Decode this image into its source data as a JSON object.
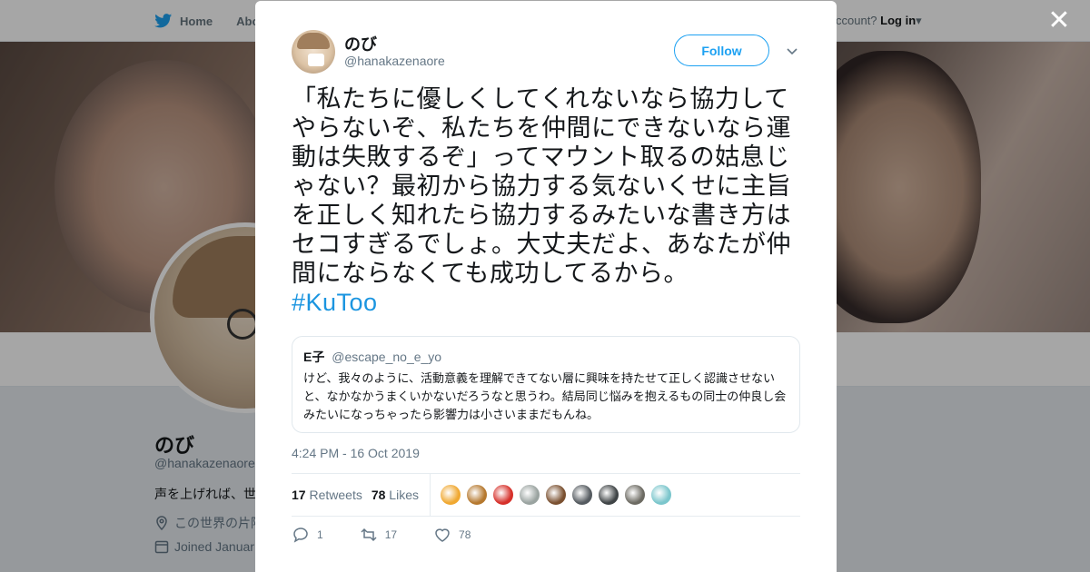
{
  "nav": {
    "home_label": "Home",
    "about_label": "Abo",
    "account_prompt": "ccount?",
    "login_label": "Log in"
  },
  "profile": {
    "name": "のび",
    "handle": "@hanakazenaore",
    "bio_fragment": "声を上げれば、世",
    "location_fragment": "この世界の片隅",
    "joined_fragment": "Joined Januar"
  },
  "tweet": {
    "author_name": "のび",
    "author_handle": "@hanakazenaore",
    "follow_label": "Follow",
    "text": "「私たちに優しくしてくれないなら協力してやらないぞ、私たちを仲間にできないなら運動は失敗するぞ」ってマウント取るの姑息じゃない？最初から協力する気ないくせに主旨を正しく知れたら協力するみたいな書き方はセコすぎるでしょ。大丈夫だよ、あなたが仲間にならなくても成功してるから。",
    "hashtag": "#KuToo",
    "timestamp": "4:24 PM - 16 Oct 2019",
    "retweets_count": "17",
    "retweets_label": "Retweets",
    "likes_count": "78",
    "likes_label": "Likes",
    "reply_count": "1",
    "retweet_action_count": "17",
    "like_action_count": "78"
  },
  "quote": {
    "name": "E子",
    "handle": "@escape_no_e_yo",
    "text": "けど、我々のように、活動意義を理解できてない層に興味を持たせて正しく認識させないと、なかなかうまくいかないだろうなと思うわ。結局同じ悩みを抱えるもの同士の仲良し会みたいになっちゃったら影響力は小さいままだもんね。"
  },
  "likers": [
    {
      "color": "#f0a830"
    },
    {
      "color": "#b5782e"
    },
    {
      "color": "#d6302a"
    },
    {
      "color": "#9aa3a0"
    },
    {
      "color": "#7a5030"
    },
    {
      "color": "#555b60"
    },
    {
      "color": "#3f4446"
    },
    {
      "color": "#6c6a62"
    },
    {
      "color": "#7bc6cc"
    }
  ],
  "colors": {
    "accent": "#1da1f2",
    "hashtag": "#1b95e0"
  }
}
